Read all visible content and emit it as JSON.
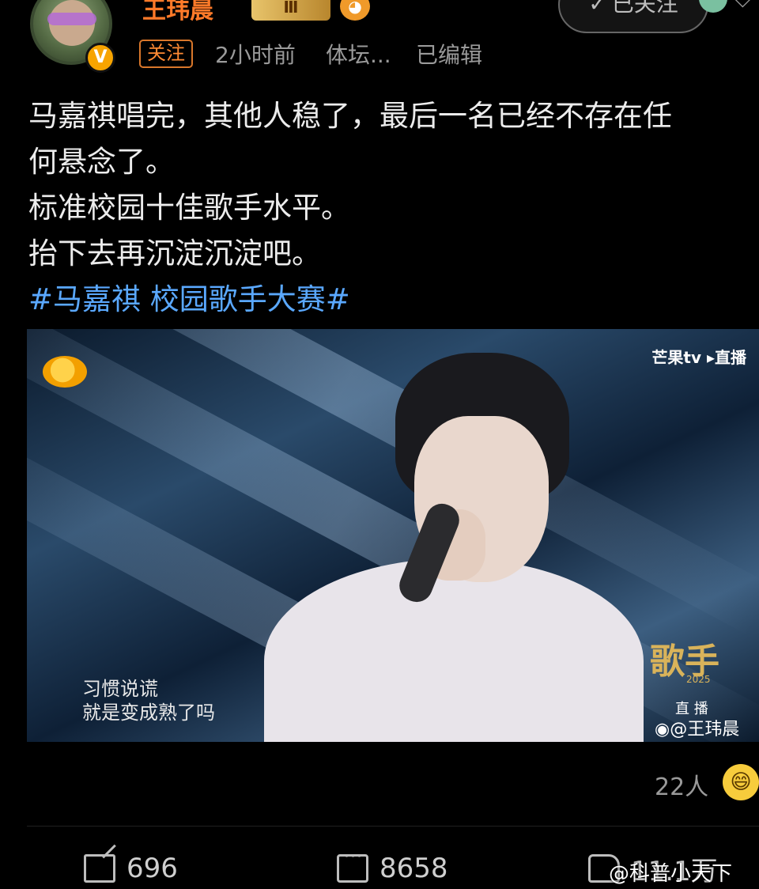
{
  "header": {
    "username": "王玮晨",
    "level_badge": "Ⅲ",
    "follow_tag": "关注",
    "time": "2小时前",
    "source": "体坛...",
    "edited": "已编辑",
    "followed_button": "已关注",
    "verified_badge": "V"
  },
  "post": {
    "lines": [
      "马嘉祺唱完，其他人稳了，最后一名已经不存在任",
      "何悬念了。",
      "标准校园十佳歌手水平。",
      "抬下去再沉淀沉淀吧。"
    ],
    "hashtag": "#马嘉祺 校园歌手大赛#"
  },
  "video": {
    "channel_logo": "芒果tv ▸直播",
    "lyrics": [
      "习惯说谎",
      "就是变成熟了吗"
    ],
    "show_logo": "歌手",
    "show_year": "2025",
    "live_tag": "直 播",
    "watermark": "@王玮晨"
  },
  "reactions": {
    "count_text": "22人",
    "emoji": "😄"
  },
  "actions": {
    "repost": "696",
    "comments": "8658",
    "likes": "11.1万"
  },
  "source_watermark": "@科普小天下"
}
